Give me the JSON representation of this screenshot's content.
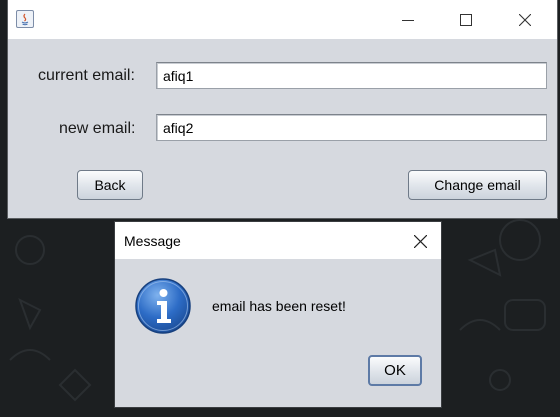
{
  "main_window": {
    "current_email_label": "current email:",
    "current_email_value": "afiq1",
    "new_email_label": "new email:",
    "new_email_value": "afiq2",
    "back_label": "Back",
    "change_email_label": "Change email",
    "icon": "java-icon"
  },
  "dialog": {
    "title": "Message",
    "message": "email has been reset!",
    "ok_label": "OK",
    "icon": "information-icon"
  },
  "colors": {
    "window_bg": "#d6d9df",
    "titlebar_bg": "#ffffff",
    "info_blue": "#2d6cc6",
    "desktop_bg": "#1c1f21"
  }
}
